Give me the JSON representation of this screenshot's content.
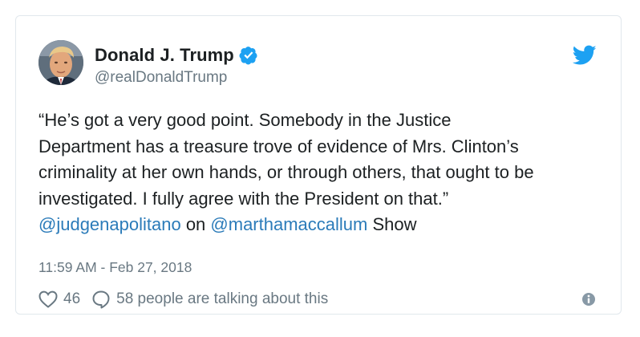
{
  "colors": {
    "text": "#1c2022",
    "muted": "#697882",
    "link": "#2b7bb9",
    "verified": "#1da1f2",
    "twitter_blue": "#1da1f2",
    "border": "#e1e8ed"
  },
  "author": {
    "display_name": "Donald J. Trump",
    "handle": "@realDonaldTrump",
    "verified_icon": "verified-badge-icon",
    "avatar": "profile-photo"
  },
  "tweet": {
    "line1": "“He’s got a very good point. Somebody in the Justice",
    "line2": "Department has a treasure trove of evidence of Mrs. Clinton’s",
    "line3": "criminality at her own hands, or through others, that ought to be",
    "line4": "investigated. I fully agree with the President on that.”",
    "mention1": "@judgenapolitano",
    "connector": " on ",
    "mention2": "@marthamaccallum",
    "suffix": " Show",
    "timestamp": "11:59 AM - Feb 27, 2018"
  },
  "footer": {
    "like_icon": "heart-icon",
    "like_count": "46",
    "reply_icon": "speech-bubble-icon",
    "talking_text": "58 people are talking about this",
    "info_icon": "info-icon"
  },
  "brand": {
    "logo_icon": "twitter-bird-icon"
  }
}
